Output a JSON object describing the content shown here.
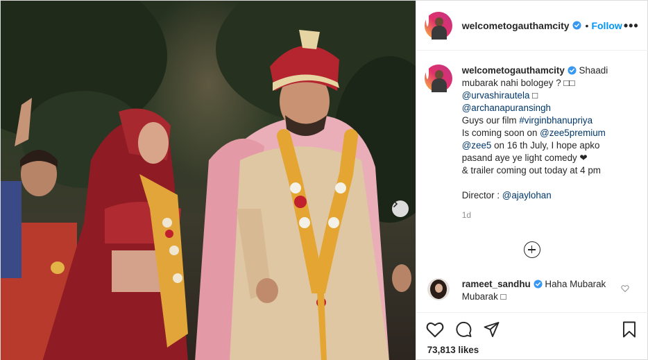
{
  "post": {
    "author": "welcometogauthamcity",
    "follow_label": "Follow",
    "dot": "•",
    "more_label": "•••",
    "caption": {
      "username": "welcometogauthamcity",
      "line1": "Shaadi",
      "line2": "mubarak nahi bologey ? □□",
      "mention1": "@urvashirautela",
      "mention1_suffix": " □",
      "mention2": "@archanapuransingh",
      "line5_prefix": "Guys our film ",
      "hashtag": "#virginbhanupriya",
      "line6_prefix": "Is coming soon on ",
      "mention3": "@zee5premium",
      "mention4": "@zee5",
      "line7_suffix": " on 16 th July, I hope apko",
      "line8": "pasand aye ye light comedy ❤",
      "line9": "& trailer coming out today at 4 pm",
      "director_prefix": "Director : ",
      "mention5": "@ajaylohan"
    },
    "time_ago": "1d"
  },
  "comment": {
    "username": "rameet_sandhu",
    "text_part1": " Haha Mubarak",
    "text_part2": "Mubarak □"
  },
  "likes": "73,813 likes",
  "icons": {
    "like": "heart-icon",
    "comment": "comment-icon",
    "share": "paper-plane-icon",
    "save": "bookmark-icon",
    "verified": "verified-badge-icon",
    "next": "chevron-right-icon",
    "load_more": "plus-circle-icon",
    "comment_like": "small-heart-icon"
  },
  "colors": {
    "link": "#00376b",
    "follow": "#0095f6",
    "verified": "#3897f0",
    "muted": "#8e8e8e"
  }
}
